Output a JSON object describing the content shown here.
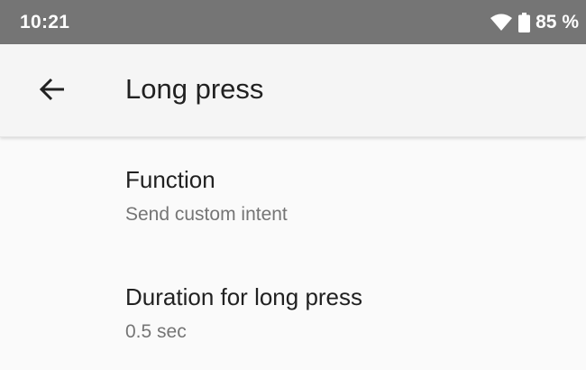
{
  "status_bar": {
    "time": "10:21",
    "battery_percent": "85 %",
    "icons": [
      "wifi-icon",
      "battery-icon"
    ]
  },
  "app_bar": {
    "title": "Long press",
    "back_icon": "arrow-back-icon"
  },
  "preferences": [
    {
      "title": "Function",
      "summary": "Send custom intent"
    },
    {
      "title": "Duration for long press",
      "summary": "0.5 sec"
    }
  ],
  "colors": {
    "status_bar": "#757575",
    "app_bar": "#f5f5f5",
    "background": "#fafafa",
    "title_text": "#212121",
    "summary_text": "#757575"
  }
}
